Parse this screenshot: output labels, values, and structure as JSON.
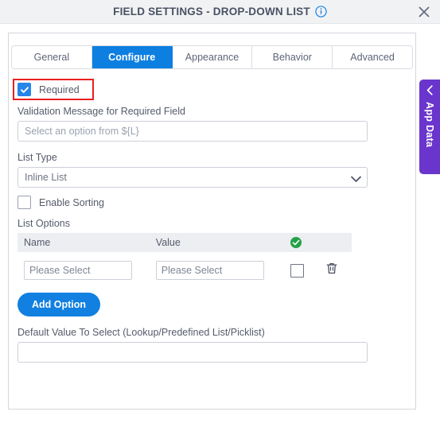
{
  "header": {
    "title": "FIELD SETTINGS - DROP-DOWN LIST",
    "info_icon": "info-circle-icon",
    "close_icon": "close-icon"
  },
  "tabs": [
    {
      "label": "General",
      "active": false
    },
    {
      "label": "Configure",
      "active": true
    },
    {
      "label": "Appearance",
      "active": false
    },
    {
      "label": "Behavior",
      "active": false
    },
    {
      "label": "Advanced",
      "active": false
    }
  ],
  "form": {
    "required": {
      "label": "Required",
      "checked": true,
      "highlight_color": "#e8201f"
    },
    "validation_message": {
      "label": "Validation Message for Required Field",
      "value": "",
      "placeholder": "Select an option from ${L}"
    },
    "list_type": {
      "label": "List Type",
      "selected": "Inline List",
      "caret_icon": "chevron-down-icon"
    },
    "enable_sorting": {
      "label": "Enable Sorting",
      "checked": false
    },
    "list_options": {
      "label": "List Options",
      "columns": [
        "Name",
        "Value"
      ],
      "status_icon": "check-circle-icon",
      "rows": [
        {
          "name_value": "",
          "name_placeholder": "Please Select",
          "value_value": "",
          "value_placeholder": "Please Select",
          "selected": false,
          "delete_icon": "trash-icon"
        }
      ]
    },
    "add_option_label": "Add Option",
    "default_value": {
      "label": "Default Value To Select (Lookup/Predefined List/Picklist)",
      "value": "",
      "placeholder": ""
    }
  },
  "side_panel": {
    "label": "App Data",
    "chevron_icon": "chevron-left-icon",
    "color": "#6a35cc"
  },
  "colors": {
    "accent_blue": "#1180e0",
    "active_tab_blue": "#0d7fe0",
    "green_check": "#2aa14a",
    "red_highlight": "#e8201f",
    "purple": "#6a35cc"
  }
}
